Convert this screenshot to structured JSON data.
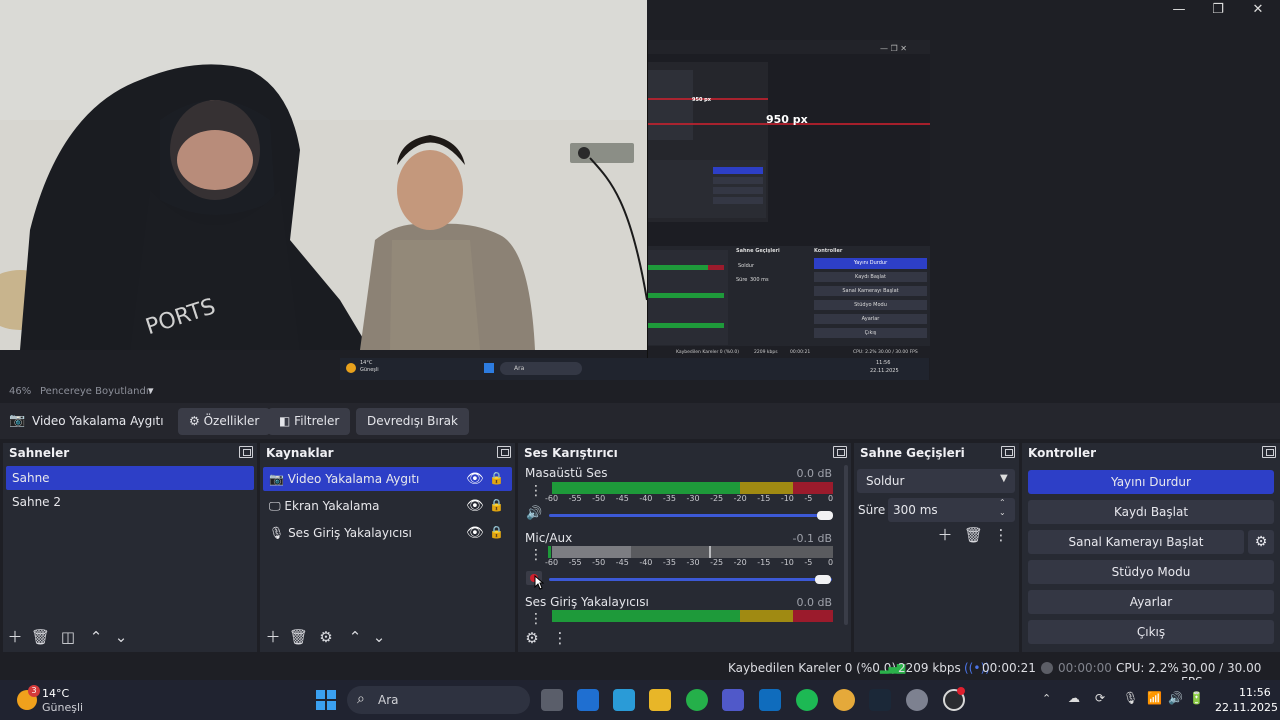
{
  "window": {
    "minimize": "—",
    "maximize": "❐",
    "close": "✕"
  },
  "preview": {
    "mirror_label": "950 px",
    "mirror_label_small": "950 px",
    "zoom_label": "46%",
    "fit_label": "Pencereye Boyutlandır"
  },
  "source_toolbar": {
    "source_name": "Video Yakalama Aygıtı",
    "properties_label": "Özellikler",
    "filters_label": "Filtreler",
    "deactivate_label": "Devredışı Bırak"
  },
  "scenes": {
    "title": "Sahneler",
    "items": [
      {
        "label": "Sahne",
        "selected": true
      },
      {
        "label": "Sahne 2",
        "selected": false
      }
    ]
  },
  "sources": {
    "title": "Kaynaklar",
    "items": [
      {
        "label": "Video Yakalama Aygıtı",
        "icon": "camera-icon",
        "selected": true
      },
      {
        "label": "Ekran Yakalama",
        "icon": "monitor-icon",
        "selected": false
      },
      {
        "label": "Ses Giriş Yakalayıcısı",
        "icon": "microphone-icon",
        "selected": false
      }
    ]
  },
  "mixer": {
    "title": "Ses Karıştırıcı",
    "channels": [
      {
        "name": "Masaüstü Ses",
        "db": "0.0 dB",
        "volume": 1.0,
        "muted": false
      },
      {
        "name": "Mic/Aux",
        "db": "-0.1 dB",
        "volume": 0.99,
        "muted": true
      },
      {
        "name": "Ses Giriş Yakalayıcısı",
        "db": "0.0 dB",
        "volume": 1.0,
        "muted": false
      }
    ],
    "ticks": [
      "-60",
      "-55",
      "-50",
      "-45",
      "-40",
      "-35",
      "-30",
      "-25",
      "-20",
      "-15",
      "-10",
      "-5",
      "0"
    ]
  },
  "transitions": {
    "title": "Sahne Geçişleri",
    "transition": "Soldur",
    "duration_label": "Süre",
    "duration_value": "300 ms"
  },
  "controls": {
    "title": "Kontroller",
    "stop_stream": "Yayını Durdur",
    "start_recording": "Kaydı Başlat",
    "start_virtual_cam": "Sanal Kamerayı Başlat",
    "studio_mode": "Stüdyo Modu",
    "settings": "Ayarlar",
    "exit": "Çıkış"
  },
  "status": {
    "dropped_frames": "Kaybedilen Kareler 0 (%0.0)",
    "bitrate": "2209 kbps",
    "stream_time": "00:00:21",
    "record_time": "00:00:00",
    "cpu": "CPU: 2.2%",
    "fps": "30.00 / 30.00 FPS"
  },
  "taskbar": {
    "weather_temp": "14°C",
    "weather_desc": "Güneşli",
    "weather_badge": "3",
    "search_label": "Ara",
    "time": "11:56",
    "date": "22.11.2025"
  },
  "mirror_taskbar": {
    "search_label": "Ara",
    "weather_temp": "14°C",
    "weather_desc": "Güneşli"
  },
  "mirror_status": {
    "dropped_frames": "Kaybedilen Kareler 0 (%0.0)",
    "bitrate": "2209 kbps",
    "stream_time": "00:00:21",
    "cpu": "CPU: 2.2%",
    "fps": "30.00 / 30.00 FPS",
    "time": "11:56",
    "date": "22.11.2025"
  },
  "mirror_panels": {
    "transitions_title": "Sahne Geçişleri",
    "transition": "Soldur",
    "duration_label": "Süre",
    "duration_value": "300 ms",
    "controls_title": "Kontroller",
    "buttons": [
      "Yayını Durdur",
      "Kaydı Başlat",
      "Sanal Kamerayı Başlat",
      "Stüdyo Modu",
      "Ayarlar",
      "Çıkış"
    ]
  },
  "colors": {
    "accent": "#2d3fc7",
    "meter_green": "#1e9a3a",
    "meter_yellow": "#a08a12",
    "meter_red": "#9b1b2c",
    "mirror_line": "#d4202e"
  }
}
